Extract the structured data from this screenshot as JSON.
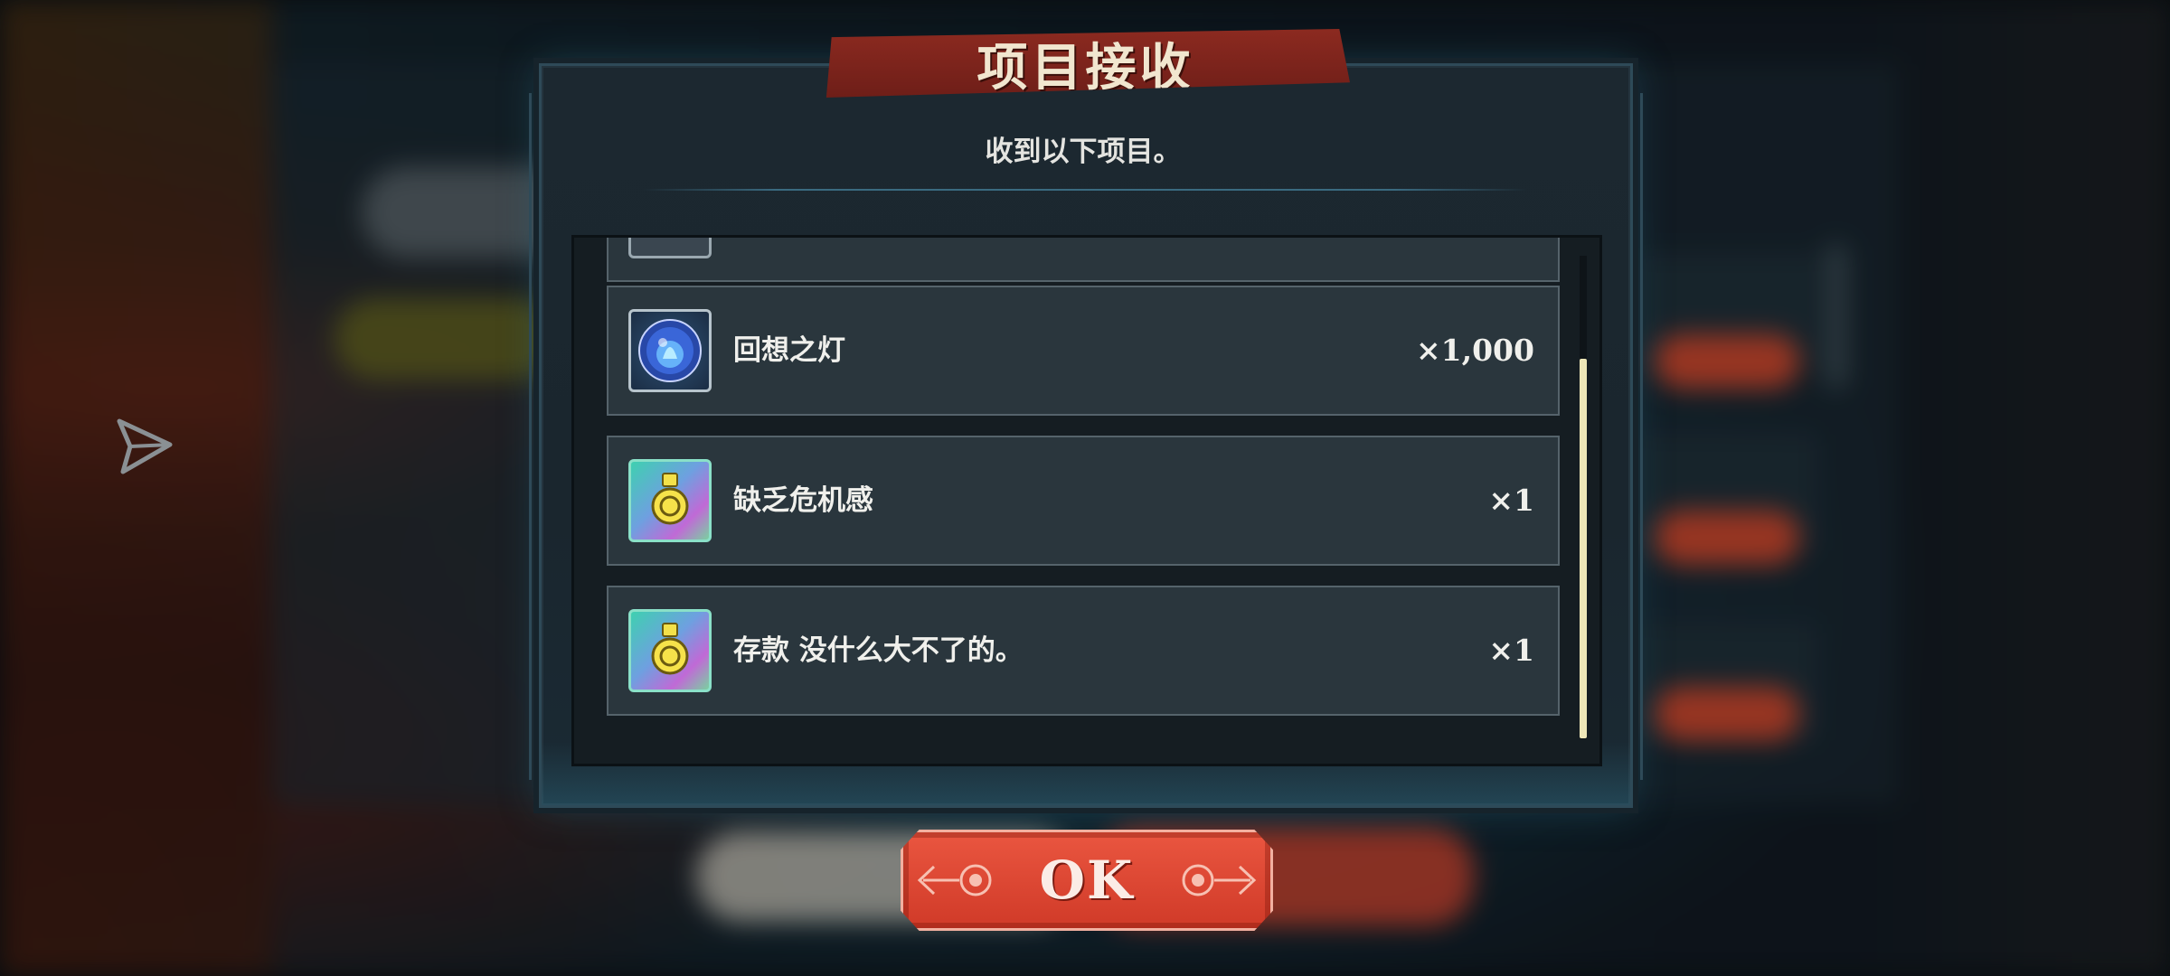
{
  "dialog": {
    "title": "项目接收",
    "subtitle": "收到以下项目。"
  },
  "items": [
    {
      "name": "回想之灯",
      "quantity": "×1,000",
      "icon": "lamp-orb-icon"
    },
    {
      "name": "缺乏危机感",
      "quantity": "×1",
      "icon": "medal-icon"
    },
    {
      "name": "存款 没什么大不了的。",
      "quantity": "×1",
      "icon": "medal-icon"
    }
  ],
  "scroll": {
    "position": 0.8
  },
  "ok_button": {
    "label": "OK"
  },
  "side": {
    "icon": "share-icon"
  },
  "colors": {
    "accent_red": "#d03a28",
    "banner_red": "#7a221a",
    "panel_bg": "#1c2830",
    "row_bg": "#2a363d",
    "scroll_thumb": "#eee7b8"
  }
}
